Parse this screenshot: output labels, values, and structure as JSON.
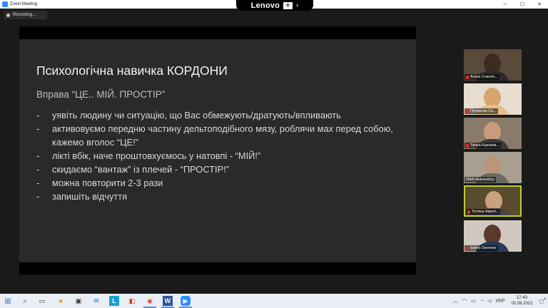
{
  "window": {
    "title": "Zoom Meeting",
    "controls": [
      "─",
      "☐",
      "✕"
    ]
  },
  "lenovo_bar": {
    "logo": "Lenovo",
    "chevron": "‹"
  },
  "recording": {
    "label": "Recording..."
  },
  "slide": {
    "title": "Психологічна навичка КОРДОНИ",
    "subtitle": "Вправа “ЦЕ.. МІЙ. ПРОСТІР”",
    "bullets": [
      "уявіть людину чи ситуацію, що Вас обмежують/дратують/впливають",
      "активовуємо передню частину дельтоподібного мязу, роблячи мах перед собою, кажемо вголос “ЦЕ!”",
      "лікті вбік, наче проштовхуємось у натовпі - “МІЙ!”",
      "скидаємо “вантаж” із плечей - “ПРОСТІР!”",
      "можна повторити 2-3 рази",
      "запишіть відчуття"
    ]
  },
  "participants": [
    {
      "name": "Аліна Соколе...",
      "bg": "#5a4a3a",
      "head": "#3b2c22",
      "body": "#2a2a2a"
    },
    {
      "name": "Петриняк Ок...",
      "bg": "#e7ddd0",
      "head": "#d8a56e",
      "body": "#e8c089"
    },
    {
      "name": "Tanya Kazanta...",
      "bg": "#8a7a6a",
      "head": "#c99a7b",
      "body": "#3a3a3a"
    },
    {
      "name": "Oleh Hukovskyy",
      "bg": "#a89f91",
      "head": "#b9967b",
      "body": "#6a6a60"
    },
    {
      "name": "Тетяна Амелі...",
      "bg": "#5a4a30",
      "head": "#c9a27a",
      "body": "#4a4050",
      "active": true
    },
    {
      "name": "Ірина Окопняк",
      "bg": "#d0c8c0",
      "head": "#5a3a2a",
      "body": "#2a3a5a"
    }
  ],
  "taskbar": {
    "icons": [
      "windows-start-icon",
      "search-icon",
      "task-view-icon",
      "file-explorer-icon",
      "store-icon",
      "mail-icon",
      "learn-icon",
      "office-icon",
      "chrome-icon",
      "word-icon",
      "zoom-icon"
    ],
    "lang": "УКР",
    "time": "17:43",
    "date": "02.06.2021",
    "notifications": "4"
  }
}
